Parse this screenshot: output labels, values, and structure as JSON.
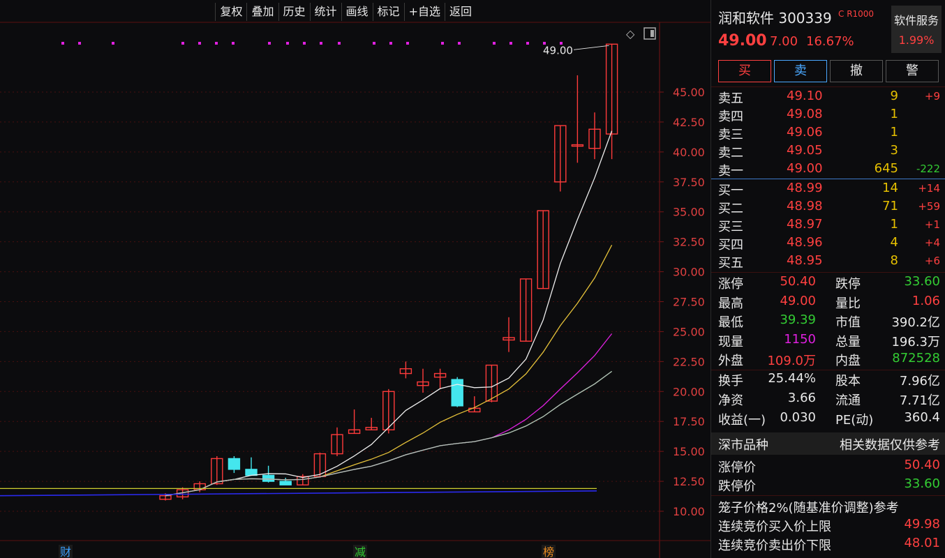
{
  "toolbar": [
    "复权",
    "叠加",
    "历史",
    "统计",
    "画线",
    "标记",
    "+自选",
    "返回"
  ],
  "chart": {
    "last_price_label": "49.00",
    "ylabels": [
      "45.00",
      "42.50",
      "40.00",
      "37.50",
      "35.00",
      "32.50",
      "30.00",
      "27.50",
      "25.00",
      "22.50",
      "20.00",
      "17.50",
      "15.00",
      "12.50",
      "10.00"
    ],
    "markers": [
      "财",
      "减",
      "榜"
    ],
    "icons": [
      "diamond-icon",
      "panel-toggle-icon"
    ]
  },
  "chart_data": {
    "type": "candlestick",
    "ylim": [
      10,
      49
    ],
    "candles": [
      {
        "o": 11.0,
        "h": 11.5,
        "l": 10.9,
        "c": 11.3
      },
      {
        "o": 11.2,
        "h": 12.0,
        "l": 11.0,
        "c": 11.8
      },
      {
        "o": 11.8,
        "h": 12.5,
        "l": 11.6,
        "c": 12.3
      },
      {
        "o": 12.3,
        "h": 14.6,
        "l": 12.2,
        "c": 14.4
      },
      {
        "o": 14.4,
        "h": 14.6,
        "l": 13.2,
        "c": 13.5
      },
      {
        "o": 13.5,
        "h": 14.5,
        "l": 13.0,
        "c": 13.0
      },
      {
        "o": 13.0,
        "h": 13.8,
        "l": 12.4,
        "c": 12.5
      },
      {
        "o": 12.5,
        "h": 12.8,
        "l": 12.2,
        "c": 12.2
      },
      {
        "o": 12.2,
        "h": 13.1,
        "l": 12.2,
        "c": 12.9
      },
      {
        "o": 12.9,
        "h": 14.9,
        "l": 12.8,
        "c": 14.8
      },
      {
        "o": 14.8,
        "h": 17.0,
        "l": 14.6,
        "c": 16.4
      },
      {
        "o": 16.5,
        "h": 18.5,
        "l": 16.5,
        "c": 16.8
      },
      {
        "o": 16.8,
        "h": 17.8,
        "l": 16.8,
        "c": 17.0
      },
      {
        "o": 16.8,
        "h": 20.2,
        "l": 16.5,
        "c": 20.0
      },
      {
        "o": 21.5,
        "h": 22.5,
        "l": 21.1,
        "c": 21.9
      },
      {
        "o": 20.5,
        "h": 21.9,
        "l": 19.9,
        "c": 20.8
      },
      {
        "o": 21.2,
        "h": 21.9,
        "l": 20.2,
        "c": 21.5
      },
      {
        "o": 21.0,
        "h": 21.2,
        "l": 18.7,
        "c": 18.8
      },
      {
        "o": 18.3,
        "h": 19.6,
        "l": 18.3,
        "c": 18.6
      },
      {
        "o": 19.2,
        "h": 22.2,
        "l": 19.1,
        "c": 22.2
      },
      {
        "o": 24.3,
        "h": 26.2,
        "l": 23.3,
        "c": 24.5
      },
      {
        "o": 24.2,
        "h": 29.4,
        "l": 24.2,
        "c": 29.4
      },
      {
        "o": 28.6,
        "h": 35.1,
        "l": 28.6,
        "c": 35.1
      },
      {
        "o": 37.5,
        "h": 42.2,
        "l": 36.7,
        "c": 42.2
      },
      {
        "o": 40.5,
        "h": 46.4,
        "l": 39.1,
        "c": 40.6
      },
      {
        "o": 40.3,
        "h": 43.3,
        "l": 39.4,
        "c": 41.9
      },
      {
        "o": 41.5,
        "h": 49.0,
        "l": 39.4,
        "c": 49.0
      }
    ]
  },
  "panel": {
    "title": "润和软件 300339",
    "badge": "C R1000",
    "category_label": "软件服务",
    "category_pct": "1.99%",
    "price": "49.00",
    "change": "7.00",
    "change_pct": "16.67%",
    "buttons": {
      "buy": "买",
      "sell": "卖",
      "cancel": "撤",
      "alert": "警"
    },
    "asks": [
      {
        "label": "卖五",
        "price": "49.10",
        "vol": "9",
        "chg": "+9"
      },
      {
        "label": "卖四",
        "price": "49.08",
        "vol": "1",
        "chg": ""
      },
      {
        "label": "卖三",
        "price": "49.06",
        "vol": "1",
        "chg": ""
      },
      {
        "label": "卖二",
        "price": "49.05",
        "vol": "3",
        "chg": ""
      },
      {
        "label": "卖一",
        "price": "49.00",
        "vol": "645",
        "chg": "-222"
      }
    ],
    "bids": [
      {
        "label": "买一",
        "price": "48.99",
        "vol": "14",
        "chg": "+14"
      },
      {
        "label": "买二",
        "price": "48.98",
        "vol": "71",
        "chg": "+59"
      },
      {
        "label": "买三",
        "price": "48.97",
        "vol": "1",
        "chg": "+1"
      },
      {
        "label": "买四",
        "price": "48.96",
        "vol": "4",
        "chg": "+4"
      },
      {
        "label": "买五",
        "price": "48.95",
        "vol": "8",
        "chg": "+6"
      }
    ],
    "stats": [
      {
        "l1": "涨停",
        "v1": "50.40",
        "l2": "跌停",
        "v2": "33.60"
      },
      {
        "l1": "最高",
        "v1": "49.00",
        "l2": "量比",
        "v2": "1.06"
      },
      {
        "l1": "最低",
        "v1": "39.39",
        "l2": "市值",
        "v2": "390.2亿"
      },
      {
        "l1": "现量",
        "v1": "1150",
        "l2": "总量",
        "v2": "196.3万"
      },
      {
        "l1": "外盘",
        "v1": "109.0万",
        "l2": "内盘",
        "v2": "872528"
      }
    ],
    "fundamentals": [
      {
        "l1": "换手",
        "v1": "25.44%",
        "l2": "股本",
        "v2": "7.96亿"
      },
      {
        "l1": "净资",
        "v1": "3.66",
        "l2": "流通",
        "v2": "7.71亿"
      },
      {
        "l1": "收益(一)",
        "v1": "0.030",
        "l2": "PE(动)",
        "v2": "360.4"
      }
    ],
    "market_label": "深市品种",
    "disclaimer": "相关数据仅供参考",
    "limit_up_label": "涨停价",
    "limit_up": "50.40",
    "limit_down_label": "跌停价",
    "limit_down": "33.60",
    "cage_label": "笼子价格2%(随基准价调整)参考",
    "auction_buy_label": "连续竞价买入价上限",
    "auction_buy": "49.98",
    "auction_sell_label": "连续竞价卖出价下限",
    "auction_sell": "48.01"
  },
  "colors": {
    "up": "#ff3b3b",
    "down": "#44e6ee",
    "bg": "#0c0c0e"
  }
}
